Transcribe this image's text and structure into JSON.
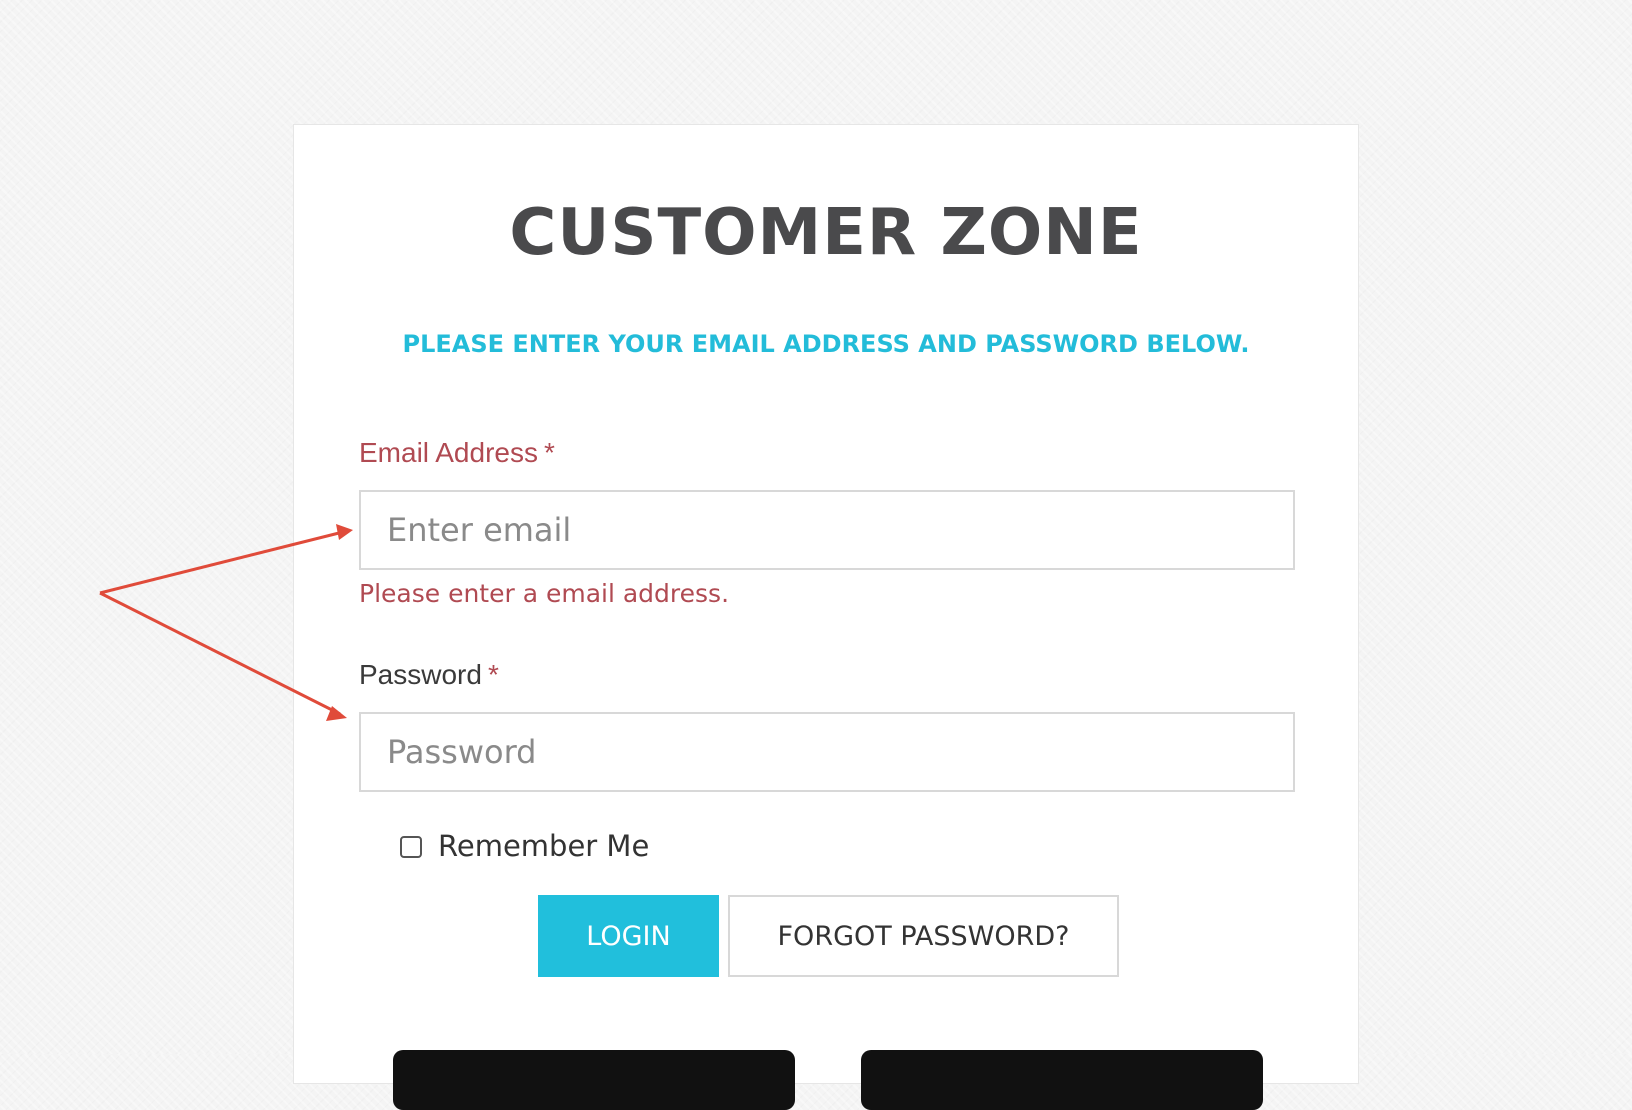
{
  "page": {
    "title": "CUSTOMER ZONE",
    "subtitle": "PLEASE ENTER YOUR EMAIL ADDRESS AND PASSWORD BELOW."
  },
  "form": {
    "email": {
      "label": "Email Address",
      "required_marker": "*",
      "placeholder": "Enter email",
      "value": "",
      "error": "Please enter a email address."
    },
    "password": {
      "label": "Password",
      "required_marker": "*",
      "placeholder": "Password",
      "value": ""
    },
    "remember": {
      "label": "Remember Me",
      "checked": false
    }
  },
  "buttons": {
    "login_label": "LOGIN",
    "forgot_label": "FORGOT PASSWORD?"
  },
  "colors": {
    "accent": "#21bfdc",
    "error": "#b04a52",
    "title": "#4a4a4c",
    "annotation_arrow": "#e04b3a"
  }
}
